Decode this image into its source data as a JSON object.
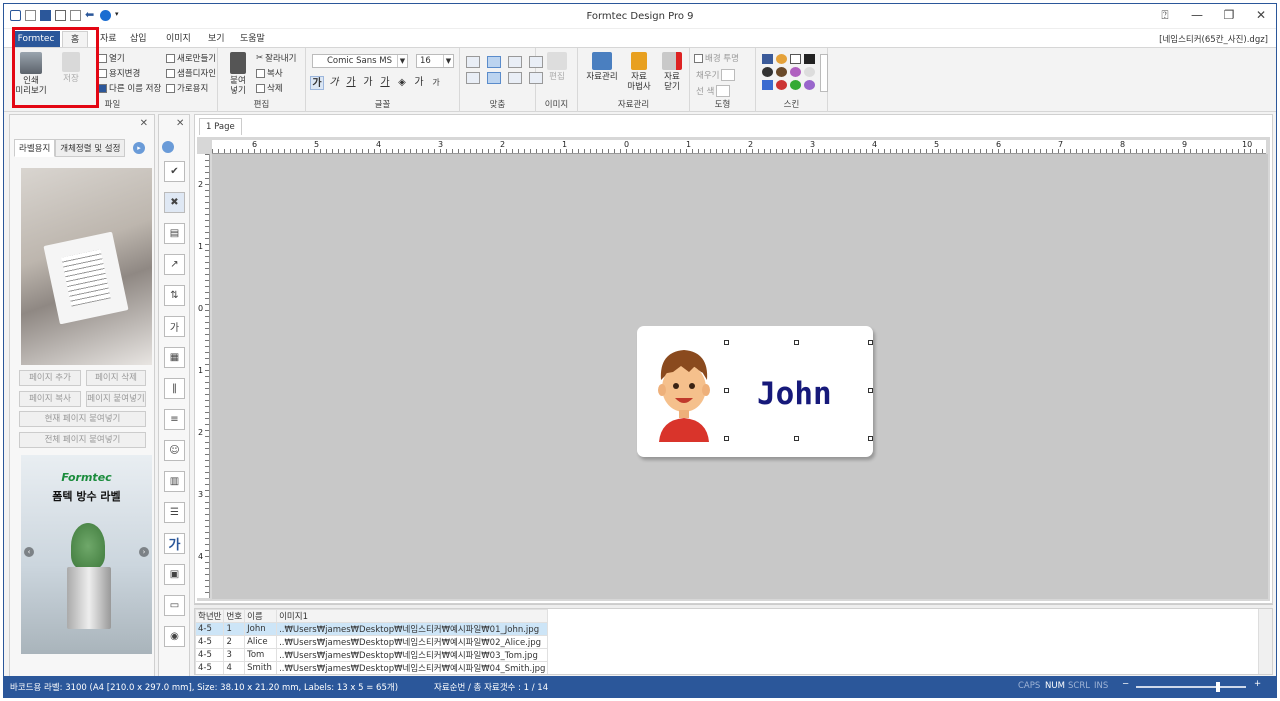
{
  "app": {
    "title": "Formtec Design Pro 9",
    "document": "[네임스티커(65칸_사진).dgz]"
  },
  "tabs": [
    "Formtec",
    "홈",
    "자료",
    "삽입",
    "이미지",
    "보기",
    "도움말"
  ],
  "ribbon": {
    "file": {
      "label": "파일",
      "print_preview": "인쇄\n미리보기",
      "save": "저장",
      "open": "열기",
      "paper_change": "용지변경",
      "save_as": "다른 이름 저장",
      "new": "새로만들기",
      "sample_design": "샘플디자인",
      "landscape_paper": "가로용지"
    },
    "edit": {
      "label": "편집",
      "paste": "붙여\n넣기",
      "cut": "잘라내기",
      "copy": "복사",
      "delete": "삭제"
    },
    "font": {
      "label": "글꼴",
      "family": "Comic Sans MS",
      "size": "16",
      "glyphs": [
        "가",
        "가",
        "가",
        "가",
        "가",
        "가",
        "가"
      ]
    },
    "align": {
      "label": "맞춤"
    },
    "image": {
      "label": "이미지",
      "edit": "편집"
    },
    "data": {
      "label": "자료관리",
      "manage": "자료관리",
      "wizard": "자료\n마법사",
      "close": "자료\n닫기"
    },
    "shape": {
      "label": "도형",
      "bg_transparent": "배경 투명",
      "fill": "채우기",
      "line": "선 색"
    },
    "skin": {
      "label": "스킨"
    }
  },
  "left_panel": {
    "tabs": [
      "라벨용지",
      "개체정렬 및 설정"
    ],
    "buttons": [
      "페이지 추가",
      "페이지 삭제",
      "페이지 복사",
      "페이지 붙여넣기",
      "현재 페이지 붙여넣기",
      "전체 페이지 붙여넣기"
    ],
    "ad_brand": "Formtec",
    "ad_product": "폼텍 방수 라벨"
  },
  "page_tab": "1 Page",
  "ruler_h": [
    "6",
    "5",
    "4",
    "3",
    "2",
    "1",
    "0",
    "1",
    "2",
    "3",
    "4",
    "5",
    "6",
    "7",
    "8",
    "9",
    "10"
  ],
  "ruler_v": [
    "2",
    "1",
    "0",
    "1",
    "2",
    "3",
    "4"
  ],
  "label_text": "John",
  "grid": {
    "headers": [
      "학년반",
      "번호",
      "이름",
      "이미지1"
    ],
    "rows": [
      [
        "4-5",
        "1",
        "John",
        "..₩Users₩james₩Desktop₩네임스티커₩예시파일₩01_John.jpg"
      ],
      [
        "4-5",
        "2",
        "Alice",
        "..₩Users₩james₩Desktop₩네임스티커₩예시파일₩02_Alice.jpg"
      ],
      [
        "4-5",
        "3",
        "Tom",
        "..₩Users₩james₩Desktop₩네임스티커₩예시파일₩03_Tom.jpg"
      ],
      [
        "4-5",
        "4",
        "Smith",
        "..₩Users₩james₩Desktop₩네임스티커₩예시파일₩04_Smith.jpg"
      ]
    ]
  },
  "status": {
    "label_info": "바코드용 라벨: 3100 (A4 [210.0 x 297.0 mm], Size: 38.10 x 21.20 mm, Labels: 13 x 5 = 65개)",
    "record_info": "자료순번 / 총 자료갯수 : 1 / 14",
    "caps": "CAPS",
    "num": "NUM",
    "scrl": "SCRL",
    "ins": "INS"
  }
}
